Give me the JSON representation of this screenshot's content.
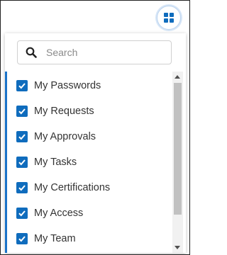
{
  "search": {
    "placeholder": "Search",
    "value": ""
  },
  "icons": {
    "apps": "apps-grid-icon",
    "search": "search-icon",
    "check": "checkmark-icon"
  },
  "colors": {
    "accent": "#0f6cbd",
    "active_bar": "#1a73c9"
  },
  "menu": {
    "items": [
      {
        "label": "My Passwords",
        "checked": true
      },
      {
        "label": "My Requests",
        "checked": true
      },
      {
        "label": "My Approvals",
        "checked": true
      },
      {
        "label": "My Tasks",
        "checked": true
      },
      {
        "label": "My Certifications",
        "checked": true
      },
      {
        "label": "My Access",
        "checked": true
      },
      {
        "label": "My Team",
        "checked": true
      }
    ]
  }
}
